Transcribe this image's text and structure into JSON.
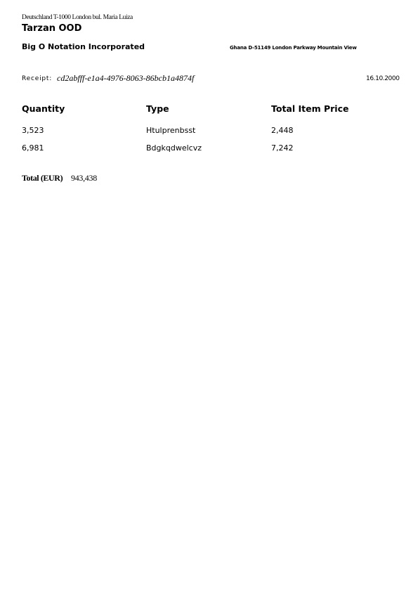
{
  "sender": {
    "address": "Deutschland T-1000 London bul. Maria Luiza",
    "name": "Tarzan OOD"
  },
  "recipient": {
    "name": "Big O Notation Incorporated",
    "address": "Ghana D-51149 London Parkway Mountain View"
  },
  "receipt": {
    "label": "Receipt:",
    "id": "cd2abfff-e1a4-4976-8063-86bcb1a4874f",
    "date": "16.10.2000"
  },
  "table": {
    "headers": [
      "Quantity",
      "Type",
      "Total Item Price"
    ],
    "rows": [
      [
        "3,523",
        "Htulprenbsst",
        "2,448"
      ],
      [
        "6,981",
        "Bdgkqdwelcvz",
        "7,242"
      ]
    ]
  },
  "total": {
    "label": "Total (EUR)",
    "value": "943,438"
  }
}
